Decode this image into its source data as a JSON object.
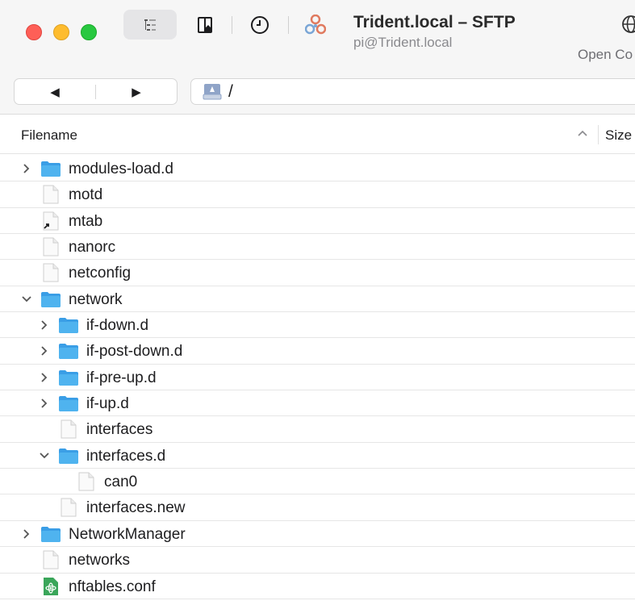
{
  "window": {
    "title": "Trident.local – SFTP",
    "subtitle": "pi@Trident.local"
  },
  "toolbar": {
    "open_connection_label": "Open Co",
    "icons": [
      "outline-view-icon",
      "bookmarks-icon",
      "history-icon",
      "transfers-icon",
      "globe-icon"
    ]
  },
  "nav": {
    "back_glyph": "◀",
    "forward_glyph": "▶",
    "path": "/"
  },
  "columns": {
    "filename": "Filename",
    "size": "Size"
  },
  "colors": {
    "folder": "#4fb3ef",
    "accent_close": "#fe5f57",
    "accent_min": "#febc2e",
    "accent_max": "#28c840"
  },
  "files": [
    {
      "name": "modules-load.d",
      "type": "folder",
      "depth": 0,
      "expanded": false
    },
    {
      "name": "motd",
      "type": "file",
      "depth": 0
    },
    {
      "name": "mtab",
      "type": "symlink",
      "depth": 0
    },
    {
      "name": "nanorc",
      "type": "file",
      "depth": 0
    },
    {
      "name": "netconfig",
      "type": "file",
      "depth": 0
    },
    {
      "name": "network",
      "type": "folder",
      "depth": 0,
      "expanded": true
    },
    {
      "name": "if-down.d",
      "type": "folder",
      "depth": 1,
      "expanded": false
    },
    {
      "name": "if-post-down.d",
      "type": "folder",
      "depth": 1,
      "expanded": false
    },
    {
      "name": "if-pre-up.d",
      "type": "folder",
      "depth": 1,
      "expanded": false
    },
    {
      "name": "if-up.d",
      "type": "folder",
      "depth": 1,
      "expanded": false
    },
    {
      "name": "interfaces",
      "type": "file",
      "depth": 1
    },
    {
      "name": "interfaces.d",
      "type": "folder",
      "depth": 1,
      "expanded": true
    },
    {
      "name": "can0",
      "type": "file",
      "depth": 2
    },
    {
      "name": "interfaces.new",
      "type": "file",
      "depth": 1
    },
    {
      "name": "NetworkManager",
      "type": "folder",
      "depth": 0,
      "expanded": false
    },
    {
      "name": "networks",
      "type": "file",
      "depth": 0
    },
    {
      "name": "nftables.conf",
      "type": "script",
      "depth": 0
    }
  ]
}
